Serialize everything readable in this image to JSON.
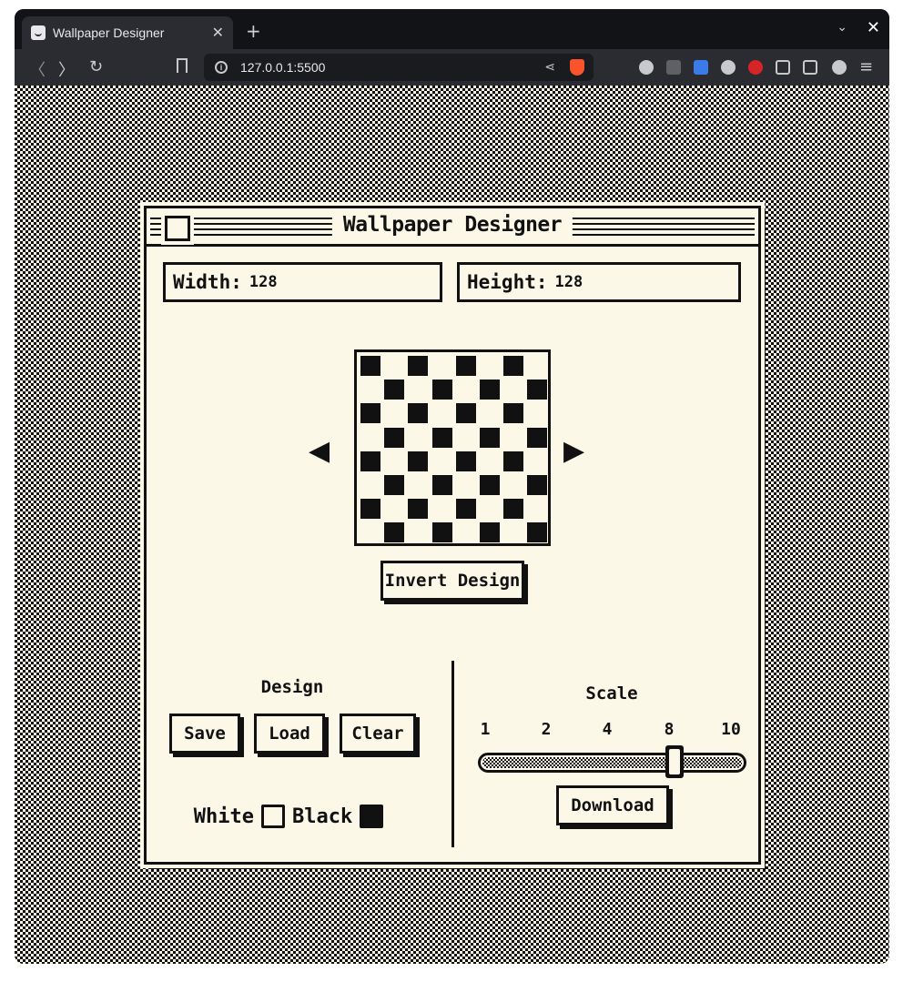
{
  "browser": {
    "tab_title": "Wallpaper Designer",
    "tab_close": "✕",
    "new_tab": "+",
    "url": "127.0.0.1:5500",
    "nav_back": "〈",
    "nav_forward": "〉",
    "reload": "↻",
    "menu": "≡",
    "window_chevron": "⌄",
    "window_close": "✕"
  },
  "app": {
    "title": "Wallpaper Designer",
    "width_label": "Width:",
    "width_value": "128",
    "height_label": "Height:",
    "height_value": "128",
    "prev_arrow": "◀",
    "next_arrow": "▶",
    "invert_button": "Invert Design",
    "design_section": {
      "title": "Design",
      "save": "Save",
      "load": "Load",
      "clear": "Clear",
      "white_label": "White",
      "black_label": "Black"
    },
    "scale_section": {
      "title": "Scale",
      "ticks": [
        "1",
        "2",
        "4",
        "8",
        "10"
      ],
      "selected": "8",
      "download": "Download"
    },
    "pattern": {
      "type": "checkerboard",
      "grid": 8,
      "foreground": "#111111",
      "background": "#fbf8e8"
    }
  },
  "colors": {
    "ink": "#111111",
    "paper": "#fbf8e8",
    "browser_dark": "#121316",
    "brave_orange": "#fb542b"
  }
}
